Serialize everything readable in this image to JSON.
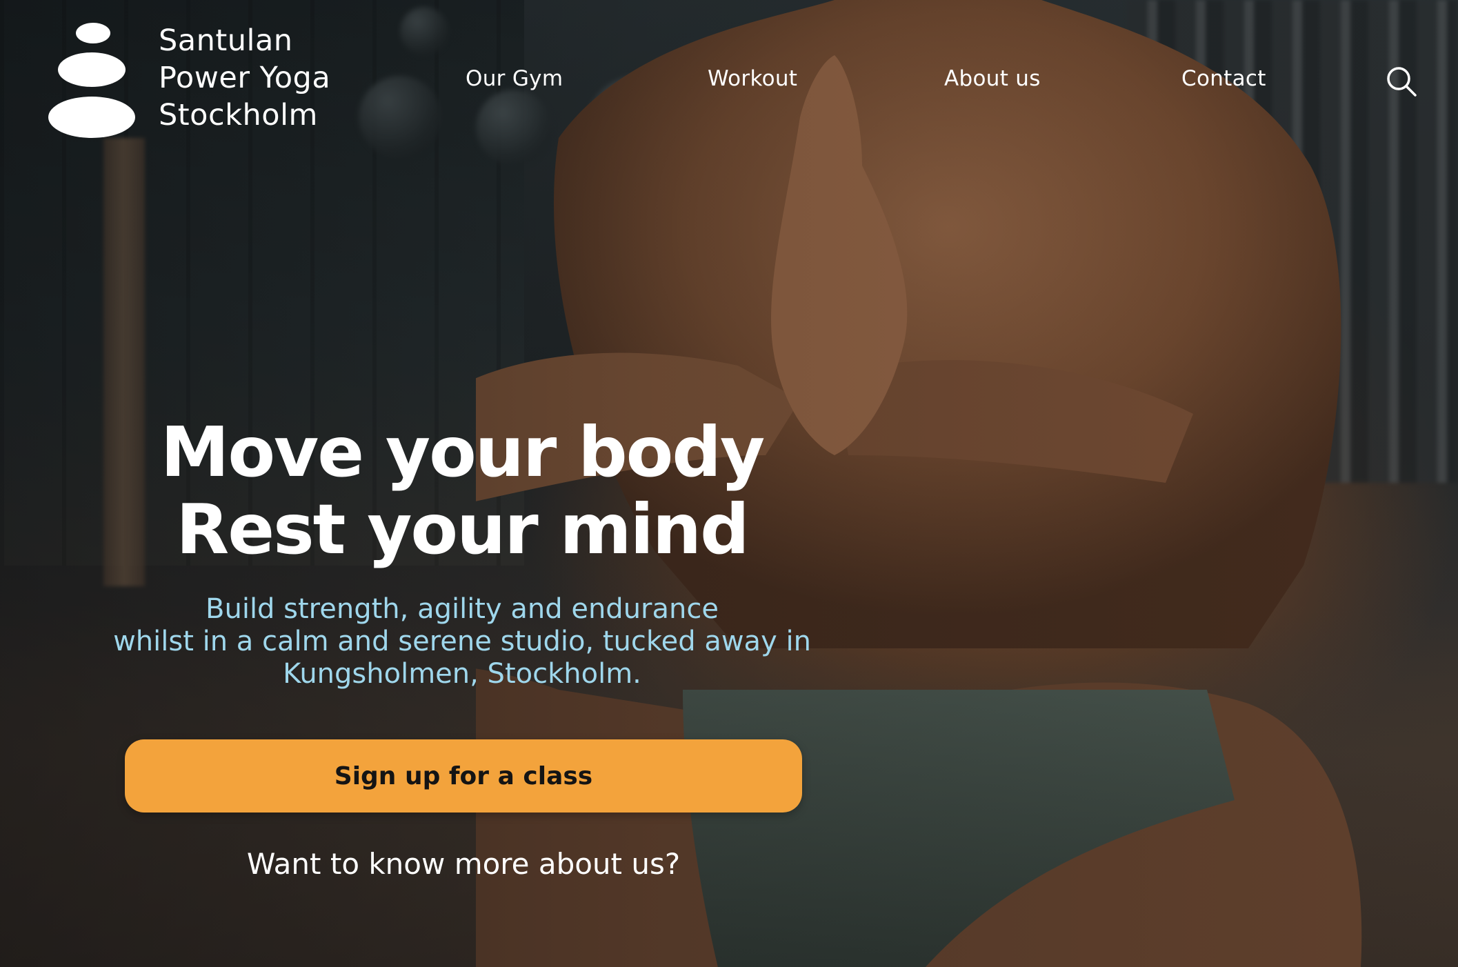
{
  "brand": {
    "name_lines": [
      "Santulan",
      "Power Yoga",
      "Stockholm"
    ],
    "logo_icon": "stacked-stones-icon"
  },
  "nav": {
    "items": [
      {
        "label": "Our Gym"
      },
      {
        "label": "Workout"
      },
      {
        "label": "About us"
      },
      {
        "label": "Contact"
      }
    ],
    "search_icon": "search-icon"
  },
  "hero": {
    "headline_lines": [
      "Move your body",
      "Rest your mind"
    ],
    "subtitle_lines": [
      "Build strength, agility and endurance",
      "whilst in a calm and serene studio, tucked away in",
      "Kungsholmen, Stockholm."
    ],
    "cta_label": "Sign up for a class",
    "more_link": "Want to know more about us?"
  },
  "colors": {
    "accent": "#f3a33c",
    "subtitle": "#9fd7ec",
    "text": "#ffffff"
  }
}
